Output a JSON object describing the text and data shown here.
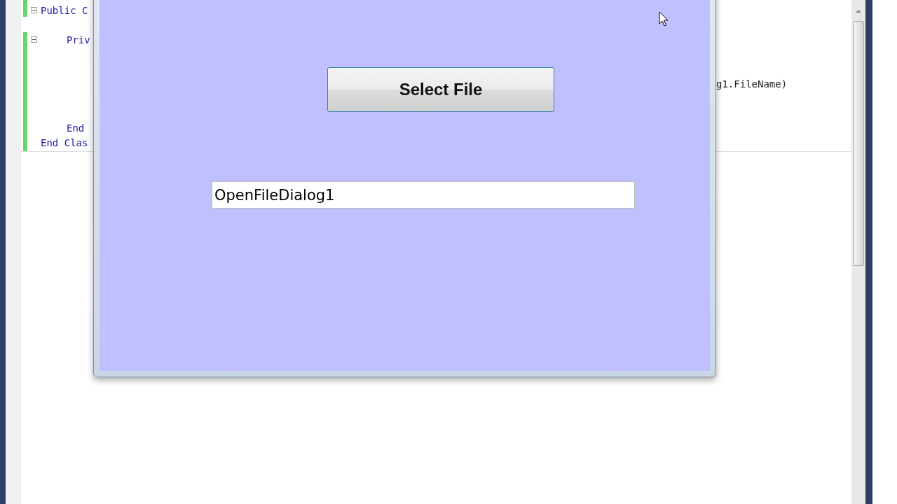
{
  "editor": {
    "lines": [
      {
        "kind": "outer",
        "text": "Public C",
        "expanded": true
      },
      {
        "kind": "blank"
      },
      {
        "kind": "inner",
        "text": "Priv",
        "expanded": true
      },
      {
        "kind": "blank"
      },
      {
        "kind": "blank"
      },
      {
        "kind": "tail",
        "text": "g1.FileName)"
      },
      {
        "kind": "blank"
      },
      {
        "kind": "blank"
      },
      {
        "kind": "inner",
        "text": "End"
      },
      {
        "kind": "outer",
        "text": "End Clas"
      }
    ]
  },
  "form_window": {
    "button": "Select File",
    "textbox_value": "OpenFileDialog1"
  }
}
